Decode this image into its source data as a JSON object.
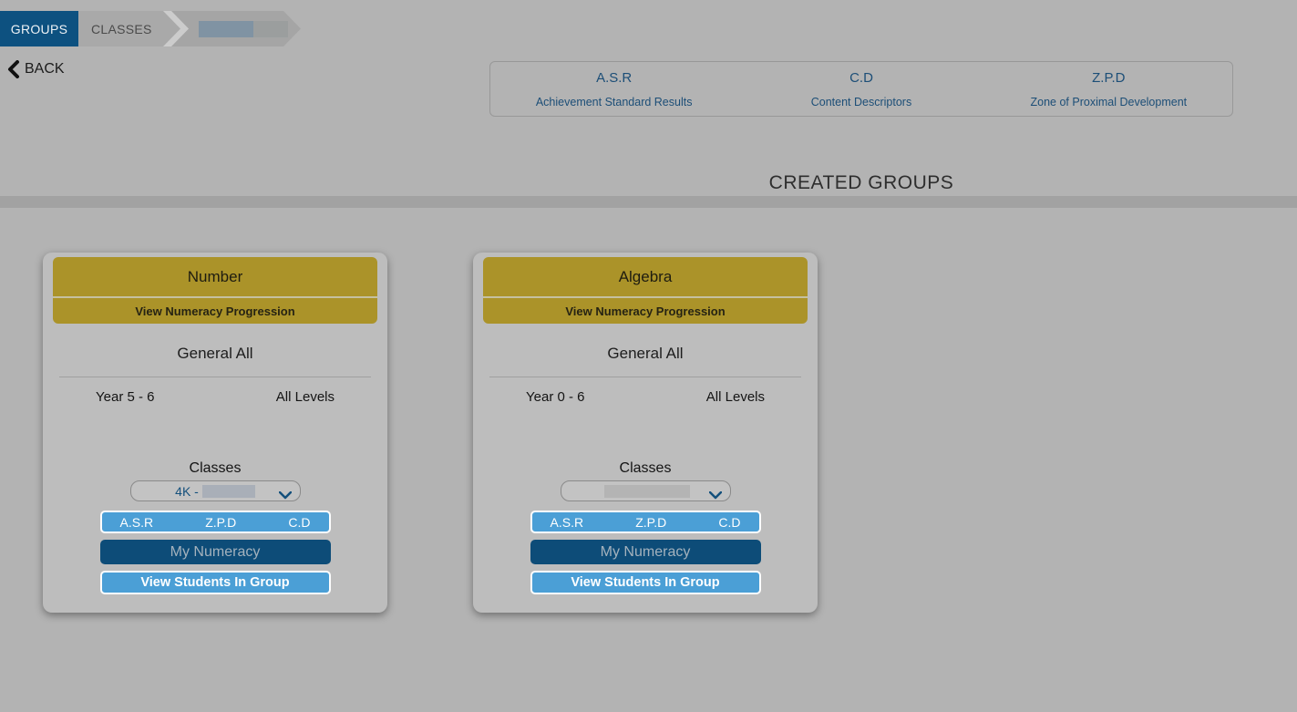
{
  "tabs": {
    "groups": {
      "label": "GROUPS",
      "active": true
    },
    "classes": {
      "label": "CLASSES",
      "active": false
    },
    "third": {
      "label": "",
      "redacted": true
    }
  },
  "back": {
    "label": "BACK",
    "icon": "chevron-left-icon"
  },
  "legend": {
    "items": [
      {
        "abbr": "A.S.R",
        "desc": "Achievement Standard Results"
      },
      {
        "abbr": "C.D",
        "desc": "Content Descriptors"
      },
      {
        "abbr": "Z.P.D",
        "desc": "Zone of Proximal Development"
      }
    ]
  },
  "page_heading": "CREATED GROUPS",
  "cards": [
    {
      "title": "Number",
      "progression_label": "View Numeracy Progression",
      "subtitle": "General All",
      "year_range": "Year 5 - 6",
      "levels": "All Levels",
      "classes_label": "Classes",
      "class_selected": "4K -",
      "class_selected_redacted": true,
      "dropdown_icon": "chevron-down-icon",
      "buttons": {
        "asr": "A.S.R",
        "zpd": "Z.P.D",
        "cd": "C.D",
        "my_numeracy": "My Numeracy",
        "view_students": "View Students In Group"
      }
    },
    {
      "title": "Algebra",
      "progression_label": "View Numeracy Progression",
      "subtitle": "General All",
      "year_range": "Year 0 - 6",
      "levels": "All Levels",
      "classes_label": "Classes",
      "class_selected": "",
      "class_selected_redacted": true,
      "dropdown_icon": "chevron-down-icon",
      "buttons": {
        "asr": "A.S.R",
        "zpd": "Z.P.D",
        "cd": "C.D",
        "my_numeracy": "My Numeracy",
        "view_students": "View Students In Group"
      }
    }
  ],
  "colors": {
    "page_bg": "#b3b3b3",
    "card_bg": "#bdbdbd",
    "active_tab_navy": "#0d5180",
    "gold_header": "#ab9329",
    "light_blue_button": "#4b9fd6",
    "navy_button": "#0d4c78",
    "legend_text_navy": "#1c4e77",
    "divider_gray": "#a2a2a2"
  }
}
